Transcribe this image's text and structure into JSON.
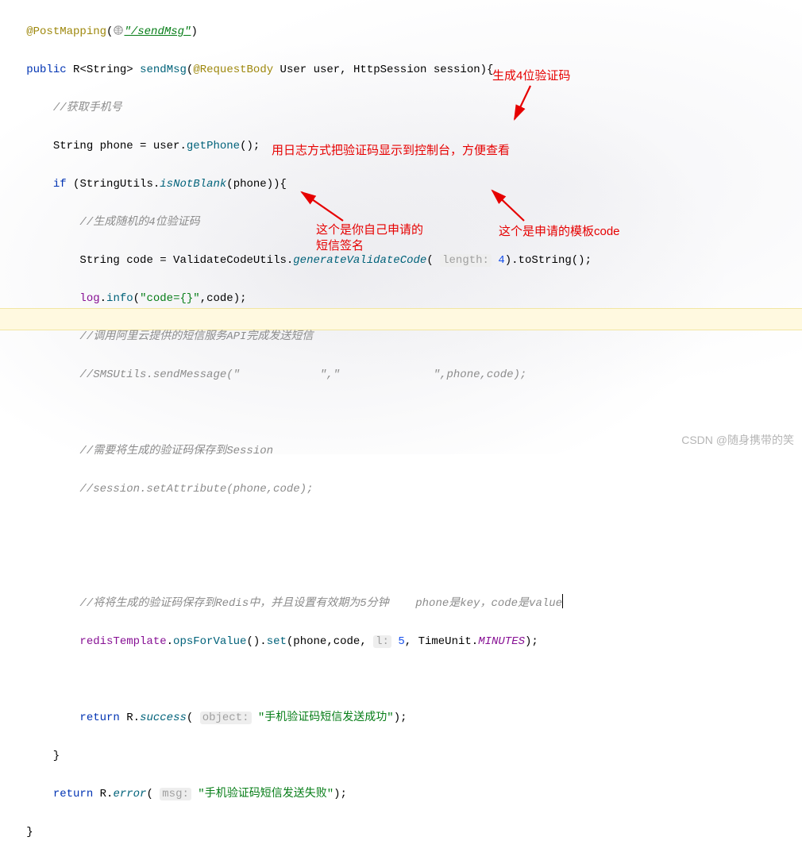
{
  "code": {
    "annotation": "@PostMapping",
    "mapping_url": "\"/sendMsg\"",
    "public": "public",
    "ret_type": "R",
    "ret_generic": "String",
    "method": "sendMsg",
    "req_ann": "@RequestBody",
    "user_type": "User",
    "user_name": "user",
    "sess_type": "HttpSession",
    "sess_name": "session",
    "c_getphone": "//获取手机号",
    "line_phone_decl": "String phone = user.getPhone();",
    "if_kw": "if",
    "stringutils": "StringUtils",
    "isnotblank": "isNotBlank",
    "phone_arg": "phone",
    "c_gen4": "//生成随机的4位验证码",
    "line_code_decl_pre": "String code = ValidateCodeUtils.",
    "genfn": "generateValidateCode",
    "hint_length": "length:",
    "four": "4",
    "to_string": ").toString();",
    "log_field": "log",
    "info_fn": "info",
    "code_fmt": "\"code={}\"",
    "code_arg": "code",
    "c_sms_api": "//调用阿里云提供的短信服务API完成发送短信",
    "c_sms_call": "//SMSUtils.sendMessage(\"            \",\"              \",phone,code);",
    "c_save_session": "//需要将生成的验证码保存到Session",
    "c_sess_set": "//session.setAttribute(phone,code);",
    "c_redis": "//将将生成的验证码保存到Redis中，并且设置有效期为5分钟    phone是key，code是value",
    "redisTemplate": "redisTemplate",
    "opsForValue": "opsForValue",
    "set_fn": "set",
    "hint_l": "l:",
    "five": "5",
    "tu": "TimeUnit",
    "minutes": "MINUTES",
    "return_kw": "return",
    "R_cls": "R",
    "success_fn": "success",
    "hint_obj": "object:",
    "succ_msg": "\"手机验证码短信发送成功\"",
    "error_fn": "error",
    "hint_msg": "msg:",
    "err_msg": "\"手机验证码短信发送失败\""
  },
  "annos": {
    "a1": "生成4位验证码",
    "a2": "用日志方式把验证码显示到控制台，方便查看",
    "a3a": "这个是你自己申请的",
    "a3b": "短信签名",
    "a4": "这个是申请的模板code"
  },
  "watermark": "CSDN @随身携带的笑"
}
